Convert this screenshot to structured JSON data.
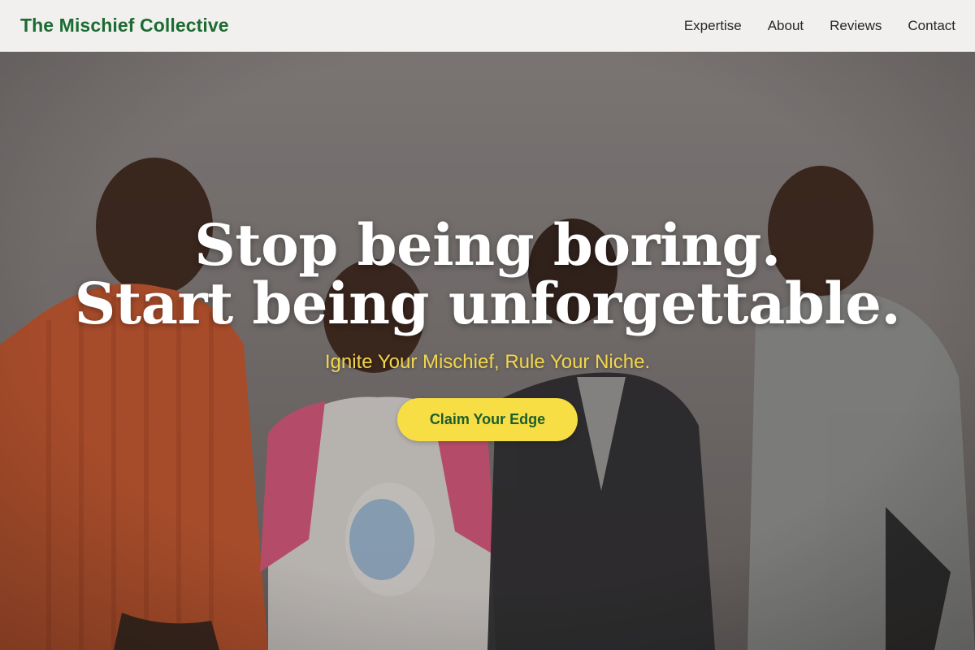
{
  "header": {
    "brand": "The Mischief Collective",
    "nav": [
      {
        "label": "Expertise"
      },
      {
        "label": "About"
      },
      {
        "label": "Reviews"
      },
      {
        "label": "Contact"
      }
    ]
  },
  "hero": {
    "headline_line1": "Stop being boring.",
    "headline_line2": "Start being unforgettable.",
    "tagline": "Ignite Your Mischief, Rule Your Niche.",
    "cta_label": "Claim Your Edge",
    "background_image": "four young people laughing together in front of a grey wall"
  },
  "colors": {
    "brand_green": "#1b6b32",
    "accent_yellow": "#f7de45",
    "tagline_yellow": "#f2d64b",
    "header_bg": "#f1f0ef"
  }
}
